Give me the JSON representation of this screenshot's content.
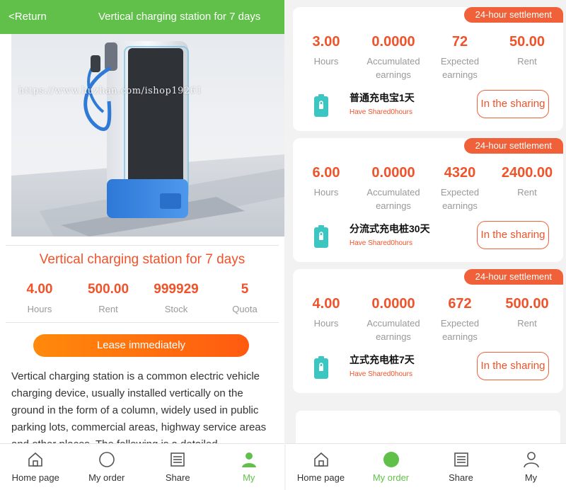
{
  "left": {
    "header": {
      "back_label": "<Return",
      "title": "Vertical charging station for 7 days"
    },
    "image_watermark": "https://www.huzhan.com/ishop19261",
    "product": {
      "title": "Vertical charging station for 7 days",
      "stats": [
        {
          "value": "4.00",
          "label": "Hours"
        },
        {
          "value": "500.00",
          "label": "Rent"
        },
        {
          "value": "999929",
          "label": "Stock"
        },
        {
          "value": "5",
          "label": "Quota"
        }
      ],
      "lease_label": "Lease immediately",
      "description": "Vertical charging station is a common electric vehicle charging device, usually installed vertically on the ground in the form of a column, widely used in public parking lots, commercial areas, highway service areas and other places. The following is a detailed"
    },
    "tabbar": [
      {
        "label": "Home page",
        "icon": "home-icon",
        "active": false
      },
      {
        "label": "My order",
        "icon": "circle-icon",
        "active": false
      },
      {
        "label": "Share",
        "icon": "list-icon",
        "active": false
      },
      {
        "label": "My",
        "icon": "user-icon",
        "active": true
      }
    ]
  },
  "right": {
    "cards": [
      {
        "badge": "24-hour settlement",
        "stats": [
          {
            "value": "3.00",
            "label": "Hours"
          },
          {
            "value": "0.0000",
            "label": "Accumulated earnings"
          },
          {
            "value": "72",
            "label": "Expected earnings"
          },
          {
            "value": "50.00",
            "label": "Rent"
          }
        ],
        "name": "普通充电宝1天",
        "shared": "Have Shared0hours",
        "button": "In the sharing"
      },
      {
        "badge": "24-hour settlement",
        "stats": [
          {
            "value": "6.00",
            "label": "Hours"
          },
          {
            "value": "0.0000",
            "label": "Accumulated earnings"
          },
          {
            "value": "4320",
            "label": "Expected earnings"
          },
          {
            "value": "2400.00",
            "label": "Rent"
          }
        ],
        "name": "分流式充电桩30天",
        "shared": "Have Shared0hours",
        "button": "In the sharing"
      },
      {
        "badge": "24-hour settlement",
        "stats": [
          {
            "value": "4.00",
            "label": "Hours"
          },
          {
            "value": "0.0000",
            "label": "Accumulated earnings"
          },
          {
            "value": "672",
            "label": "Expected earnings"
          },
          {
            "value": "500.00",
            "label": "Rent"
          }
        ],
        "name": "立式充电桩7天",
        "shared": "Have Shared0hours",
        "button": "In the sharing"
      }
    ],
    "tabbar": [
      {
        "label": "Home page",
        "icon": "home-icon",
        "active": false
      },
      {
        "label": "My order",
        "icon": "circle-icon",
        "active": true
      },
      {
        "label": "Share",
        "icon": "list-icon",
        "active": false
      },
      {
        "label": "My",
        "icon": "user-icon",
        "active": false
      }
    ]
  },
  "colors": {
    "brand_green": "#61c04a",
    "accent_orange": "#f0522a",
    "badge_orange": "#f0613a",
    "muted_text": "#999999"
  }
}
